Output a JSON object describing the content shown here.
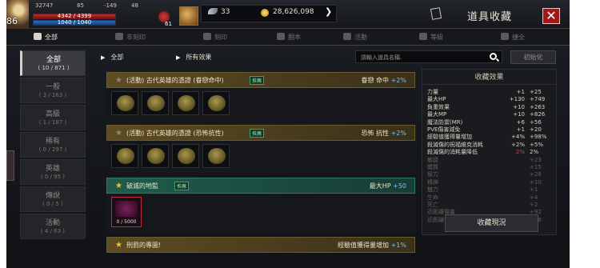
{
  "player": {
    "level": "86",
    "power": "32747",
    "stat_a": "85",
    "stat_b": "-149",
    "stat_c": "48",
    "hp": "4342 / 4399",
    "mp": "1040 / 1040",
    "potion_count": "61"
  },
  "currency": {
    "wings": "33",
    "gold": "28,626,098"
  },
  "header": {
    "title": "道具收藏",
    "close": "✕"
  },
  "tabs": [
    {
      "label": "全部"
    },
    {
      "label": "非刻印"
    },
    {
      "label": "刻印"
    },
    {
      "label": "翻本"
    },
    {
      "label": "活動"
    },
    {
      "label": "等級"
    },
    {
      "label": "捷全"
    }
  ],
  "categories": [
    {
      "name": "全部",
      "count": "( 10 / 871 )"
    },
    {
      "name": "一般",
      "count": "( 3 / 163 )"
    },
    {
      "name": "高級",
      "count": "( 1 / 187 )"
    },
    {
      "name": "稀有",
      "count": "( 0 / 297 )"
    },
    {
      "name": "英雄",
      "count": "( 0 / 95 )"
    },
    {
      "name": "傳說",
      "count": "( 0 / 5 )"
    },
    {
      "name": "活動",
      "count": "( 4 / 63 )"
    }
  ],
  "filters": {
    "scope": "全部",
    "effect": "所有效果"
  },
  "search": {
    "placeholder": "請輸入道具名稱."
  },
  "reset_label": "初始化",
  "collections": [
    {
      "name": "(活動) 古代英雄的憑證 (眷戀命中)",
      "badge": "推薦",
      "bonus_label": "眷戀 命中",
      "bonus_value": "+2%"
    },
    {
      "name": "(活動) 古代英雄的憑證 (恐怖抗性)",
      "badge": "推薦",
      "bonus_label": "恐怖 抗性",
      "bonus_value": "+2%"
    },
    {
      "name": "破滅的地監",
      "badge": "推薦",
      "bonus_label": "最大HP",
      "bonus_value": "+50",
      "progress": "0 / 5000"
    },
    {
      "name": "刑罰的專圖!",
      "bonus_label": "經驗值獲得量增加",
      "bonus_value": "+1%"
    }
  ],
  "effects": {
    "title": "收藏效果",
    "rows": [
      {
        "name": "力量",
        "add": "+1",
        "total": "+25"
      },
      {
        "name": "最大HP",
        "add": "+130",
        "total": "+749"
      },
      {
        "name": "負重效果",
        "add": "+10",
        "total": "+263"
      },
      {
        "name": "最大MP",
        "add": "+10",
        "total": "+826"
      },
      {
        "name": "魔法防禦(MR)",
        "add": "+6",
        "total": "+56"
      },
      {
        "name": "PVE傷害減免",
        "add": "+1",
        "total": "+20"
      },
      {
        "name": "經驗值獲得量增加",
        "add": "+4%",
        "total": "+98%"
      },
      {
        "name": "殺滅傷的祝福維克消耗",
        "add": "+2%",
        "total": "+5%"
      },
      {
        "name": "殺滅傷的消耗量降低",
        "add": "2%",
        "total": "2%"
      },
      {
        "name": "敏捷",
        "add": "",
        "total": "+23"
      },
      {
        "name": "體質",
        "add": "",
        "total": "+15"
      },
      {
        "name": "智力",
        "add": "",
        "total": "+28"
      },
      {
        "name": "精神",
        "add": "",
        "total": "+10"
      },
      {
        "name": "魅力",
        "add": "",
        "total": "+1"
      },
      {
        "name": "生命",
        "add": "",
        "total": "+4"
      },
      {
        "name": "死亡",
        "add": "",
        "total": "+2"
      },
      {
        "name": "近距離傷害",
        "add": "",
        "total": "+92"
      },
      {
        "name": "近距離命中",
        "add": "",
        "total": "+28"
      }
    ],
    "summary_label": "收藏現況"
  }
}
